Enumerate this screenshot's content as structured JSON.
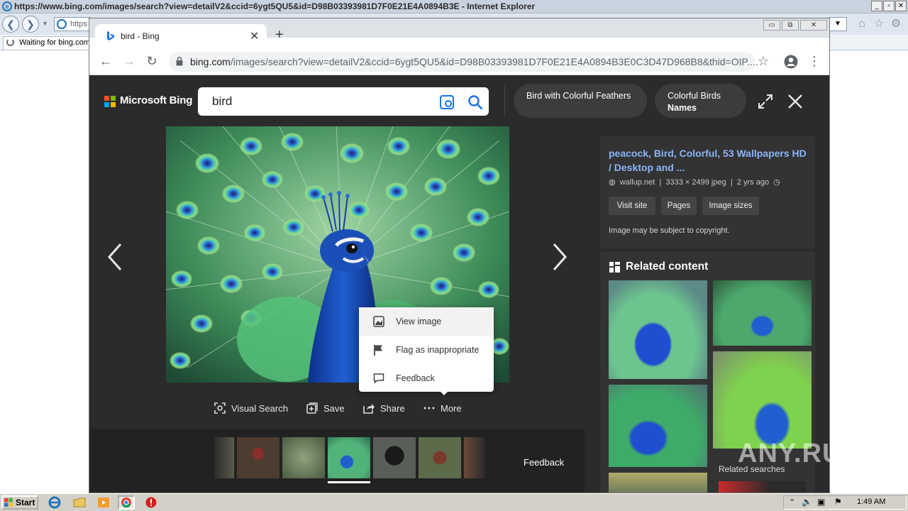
{
  "ie": {
    "title": "https://www.bing.com/images/search?view=detailV2&ccid=6ygt5QU5&id=D98B03393981D7F0E21E4A0894B3E - Internet Explorer",
    "address_fragment": "https",
    "tab_label": "Waiting for bing.com",
    "window_controls": [
      "_",
      "▫",
      "✕"
    ]
  },
  "chrome": {
    "tab_title": "bird - Bing",
    "tab_close": "✕",
    "new_tab": "+",
    "url_host": "bing.com",
    "url_path": "/images/search?view=detailV2&ccid=6ygt5QU5&id=D98B03393981D7F0E21E4A0894B3E0C3D47D968B8&thid=OIP....",
    "window_controls": [
      "▭",
      "⧉",
      "✕"
    ]
  },
  "bing": {
    "brand": "Microsoft Bing",
    "search_value": "bird",
    "pills": [
      {
        "text": "Bird with Colorful Feathers",
        "bold": ""
      },
      {
        "text": "Colorful Birds",
        "bold": "Names"
      }
    ],
    "context_menu": [
      {
        "label": "View image",
        "icon": "view-image-icon"
      },
      {
        "label": "Flag as inappropriate",
        "icon": "flag-icon"
      },
      {
        "label": "Feedback",
        "icon": "feedback-icon"
      }
    ],
    "actions": [
      {
        "label": "Visual Search",
        "icon": "visual-search-icon"
      },
      {
        "label": "Save",
        "icon": "save-icon"
      },
      {
        "label": "Share",
        "icon": "share-icon"
      },
      {
        "label": "More",
        "icon": "more-icon"
      }
    ],
    "filmstrip_feedback": "Feedback",
    "info": {
      "title": "peacock, Bird, Colorful, 53 Wallpapers HD / Desktop and ...",
      "source": "wallup.net",
      "dimensions": "3333 × 2499 jpeg",
      "age": "2 yrs ago",
      "buttons": [
        "Visit site",
        "Pages",
        "Image sizes"
      ],
      "copyright": "Image may be subject to copyright."
    },
    "related_title": "Related content",
    "related_searches": "Related searches"
  },
  "watermark": "ANY.RUN",
  "taskbar": {
    "start": "Start",
    "clock": "1:49 AM"
  },
  "colors": {
    "bing_bg": "#2b2b2b",
    "link": "#8ab4f8",
    "peacock_blue": "#1a56c7",
    "peacock_green": "#3fb36b"
  }
}
